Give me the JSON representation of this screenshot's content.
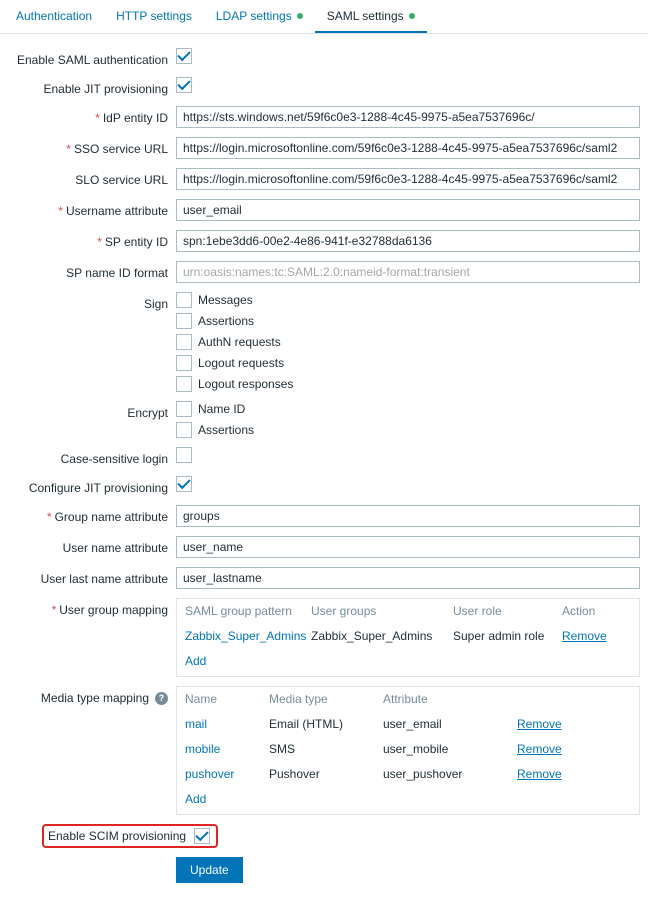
{
  "tabs": {
    "authentication": "Authentication",
    "http": "HTTP settings",
    "ldap": "LDAP settings",
    "saml": "SAML settings"
  },
  "labels": {
    "enable_saml": "Enable SAML authentication",
    "enable_jit": "Enable JIT provisioning",
    "idp_entity": "IdP entity ID",
    "sso_url": "SSO service URL",
    "slo_url": "SLO service URL",
    "username_attr": "Username attribute",
    "sp_entity": "SP entity ID",
    "sp_nameid": "SP name ID format",
    "sign": "Sign",
    "encrypt": "Encrypt",
    "case_sensitive": "Case-sensitive login",
    "configure_jit": "Configure JIT provisioning",
    "group_attr": "Group name attribute",
    "user_attr": "User name attribute",
    "lastname_attr": "User last name attribute",
    "ugm": "User group mapping",
    "mtm": "Media type mapping",
    "enable_scim": "Enable SCIM provisioning"
  },
  "values": {
    "idp_entity": "https://sts.windows.net/59f6c0e3-1288-4c45-9975-a5ea7537696c/",
    "sso_url": "https://login.microsoftonline.com/59f6c0e3-1288-4c45-9975-a5ea7537696c/saml2",
    "slo_url": "https://login.microsoftonline.com/59f6c0e3-1288-4c45-9975-a5ea7537696c/saml2",
    "username_attr": "user_email",
    "sp_entity": "spn:1ebe3dd6-00e2-4e86-941f-e32788da6136",
    "sp_nameid_placeholder": "urn:oasis:names:tc:SAML:2.0:nameid-format:transient",
    "group_attr": "groups",
    "user_attr": "user_name",
    "lastname_attr": "user_lastname"
  },
  "sign_opts": {
    "messages": "Messages",
    "assertions": "Assertions",
    "authn": "AuthN requests",
    "logout_req": "Logout requests",
    "logout_resp": "Logout responses"
  },
  "encrypt_opts": {
    "nameid": "Name ID",
    "assertions": "Assertions"
  },
  "ugm": {
    "headers": {
      "pattern": "SAML group pattern",
      "groups": "User groups",
      "role": "User role",
      "action": "Action"
    },
    "rows": [
      {
        "pattern": "Zabbix_Super_Admins",
        "groups": "Zabbix_Super_Admins",
        "role": "Super admin role",
        "action": "Remove"
      }
    ],
    "add": "Add"
  },
  "mtm": {
    "headers": {
      "name": "Name",
      "type": "Media type",
      "attr": "Attribute"
    },
    "rows": [
      {
        "name": "mail",
        "type": "Email (HTML)",
        "attr": "user_email",
        "action": "Remove"
      },
      {
        "name": "mobile",
        "type": "SMS",
        "attr": "user_mobile",
        "action": "Remove"
      },
      {
        "name": "pushover",
        "type": "Pushover",
        "attr": "user_pushover",
        "action": "Remove"
      }
    ],
    "add": "Add"
  },
  "buttons": {
    "update": "Update"
  }
}
